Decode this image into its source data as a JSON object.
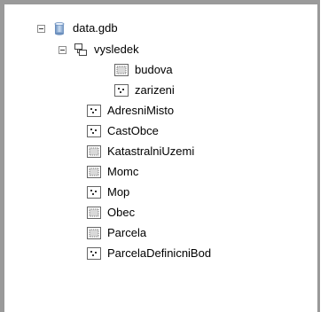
{
  "tree": {
    "root": {
      "label": "data.gdb",
      "icon": "geodatabase-icon"
    },
    "dataset": {
      "label": "vysledek",
      "icon": "feature-dataset-icon"
    },
    "dataset_children": [
      {
        "label": "budova",
        "icon": "polygon-feature-class-icon"
      },
      {
        "label": "zarizeni",
        "icon": "point-feature-class-icon"
      }
    ],
    "items": [
      {
        "label": "AdresniMisto",
        "icon": "point-feature-class-icon"
      },
      {
        "label": "CastObce",
        "icon": "point-feature-class-icon"
      },
      {
        "label": "KatastralniUzemi",
        "icon": "polygon-feature-class-icon"
      },
      {
        "label": "Momc",
        "icon": "polygon-feature-class-icon"
      },
      {
        "label": "Mop",
        "icon": "point-feature-class-icon"
      },
      {
        "label": "Obec",
        "icon": "polygon-feature-class-icon"
      },
      {
        "label": "Parcela",
        "icon": "polygon-feature-class-icon"
      },
      {
        "label": "ParcelaDefinicniBod",
        "icon": "point-feature-class-icon"
      }
    ]
  }
}
